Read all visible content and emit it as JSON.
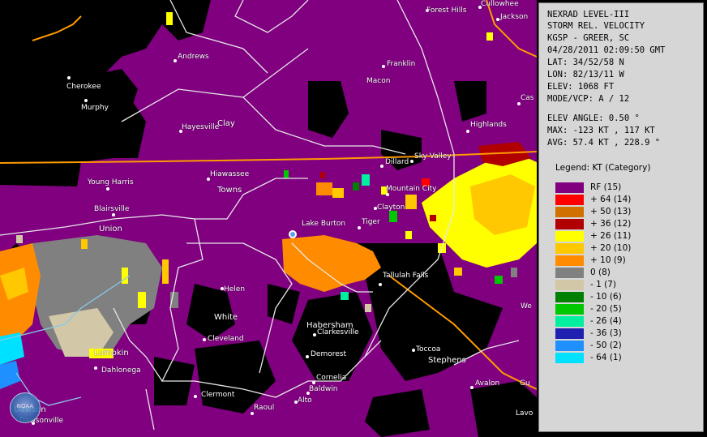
{
  "panel": {
    "lines": [
      "NEXRAD LEVEL-III",
      "STORM REL. VELOCITY",
      "KGSP - GREER, SC",
      "04/28/2011 02:09:50 GMT",
      "LAT: 34/52/58 N",
      "LON: 82/13/11 W",
      "ELEV: 1068 FT",
      "MODE/VCP: A / 12"
    ],
    "stats": [
      "ELEV ANGLE: 0.50 °",
      "MAX: -123 KT , 117 KT",
      "AVG: 57.4 KT , 228.9 °"
    ],
    "legend_title": "Legend: KT (Category)",
    "legend": [
      {
        "label": "RF  (15)",
        "color": "#800080"
      },
      {
        "label": "+ 64  (14)",
        "color": "#ff0000"
      },
      {
        "label": "+ 50  (13)",
        "color": "#d07000"
      },
      {
        "label": "+ 36  (12)",
        "color": "#b00000"
      },
      {
        "label": "+ 26  (11)",
        "color": "#ffff00"
      },
      {
        "label": "+ 20  (10)",
        "color": "#ffc800"
      },
      {
        "label": "+ 10  (9)",
        "color": "#ff8c00"
      },
      {
        "label": "0  (8)",
        "color": "#808080"
      },
      {
        "label": "- 1  (7)",
        "color": "#d2c8a8"
      },
      {
        "label": "- 10  (6)",
        "color": "#008000"
      },
      {
        "label": "- 20  (5)",
        "color": "#00c800"
      },
      {
        "label": "- 26  (4)",
        "color": "#00f0a0"
      },
      {
        "label": "- 36  (3)",
        "color": "#2020b0"
      },
      {
        "label": "- 50  (2)",
        "color": "#1e90ff"
      },
      {
        "label": "- 64  (1)",
        "color": "#00e0ff"
      }
    ]
  },
  "map": {
    "counties": [
      "Clay",
      "Towns",
      "Union",
      "White",
      "Lumpkin",
      "Habersham",
      "Dawson"
    ],
    "cities": [
      "Forest Hills",
      "Cullowhee",
      "Jackson",
      "Andrews",
      "Franklin",
      "Cherokee",
      "Macon",
      "Murphy",
      "Hayesville",
      "Highlands",
      "Cas",
      "Dillard",
      "Sky Valley",
      "Young Harris",
      "Hiawassee",
      "Mountain City",
      "Blairsville",
      "Clayton",
      "Lake Burton",
      "Tiger",
      "Tallulah Falls",
      "Helen",
      "We",
      "Cleveland",
      "Clarkesville",
      "Toccoa",
      "Stephens",
      "Dahlonega",
      "Demorest",
      "Cornelia",
      "Baldwin",
      "Avalon",
      "Gu",
      "Clermont",
      "Raoul",
      "Alto",
      "Dawsonville",
      "Lavo"
    ],
    "logo_text": "NOAA"
  }
}
